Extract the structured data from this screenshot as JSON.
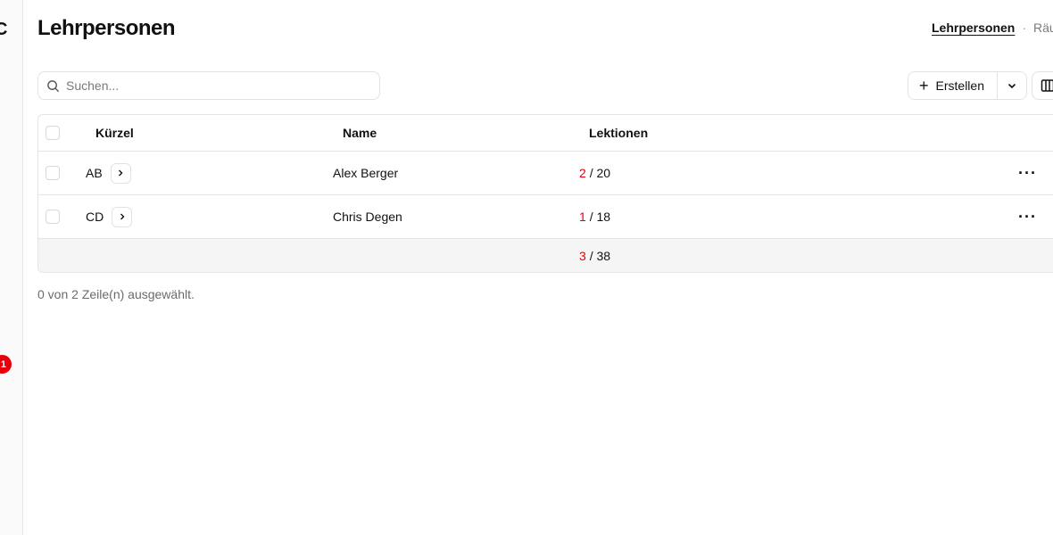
{
  "sidebar": {
    "glyph": "C",
    "badge": "1"
  },
  "page": {
    "title": "Lehrpersonen"
  },
  "topnav": {
    "active": "Lehrpersonen",
    "separator": "·",
    "next": "Räume"
  },
  "toolbar": {
    "search_placeholder": "Suchen...",
    "search_value": "",
    "create_label": "Erstellen",
    "create_icon": "plus-icon",
    "dropdown_icon": "chevron-down-icon",
    "columns_icon": "columns-icon"
  },
  "table": {
    "headers": {
      "abbr": "Kürzel",
      "name": "Name",
      "lessons": "Lektionen"
    },
    "rows": [
      {
        "abbr": "AB",
        "name": "Alex Berger",
        "lessons_used": "2",
        "lessons_total": "/ 20"
      },
      {
        "abbr": "CD",
        "name": "Chris Degen",
        "lessons_used": "1",
        "lessons_total": "/ 18"
      }
    ],
    "footer": {
      "lessons_used": "3",
      "lessons_total": "/ 38"
    }
  },
  "status": {
    "selection_text": "0 von 2 Zeile(n) ausgewählt."
  },
  "colors": {
    "accent_red": "#e7000b",
    "border": "#e5e5e5"
  }
}
